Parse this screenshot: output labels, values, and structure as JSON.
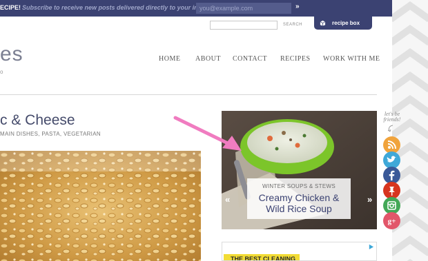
{
  "topbar": {
    "lead": "ECIPE!",
    "message": "Subscribe to receive new posts delivered directly to your inbox:",
    "email_placeholder": "you@example.com",
    "submit": "»"
  },
  "header": {
    "search_button": "SEARCH",
    "recipe_box_label": "recipe box",
    "logo_fragment": "es",
    "logo_sub": "o"
  },
  "nav": {
    "items": [
      "HOME",
      "ABOUT",
      "CONTACT",
      "RECIPES",
      "WORK WITH ME"
    ]
  },
  "post": {
    "title": "c & Cheese",
    "categories": "MAIN DISHES, PASTA, VEGETARIAN"
  },
  "slider": {
    "category": "WINTER SOUPS & STEWS",
    "title": "Creamy Chicken & Wild Rice Soup",
    "prev": "«",
    "next": "»"
  },
  "ad": {
    "text": "THE BEST CLEANING"
  },
  "social": {
    "label_line1": "let's be",
    "label_line2": "friends!",
    "items": [
      {
        "name": "rss-icon",
        "color": "#f0a33c"
      },
      {
        "name": "twitter-icon",
        "color": "#3fa8d8"
      },
      {
        "name": "facebook-icon",
        "color": "#3a5998"
      },
      {
        "name": "pinterest-icon",
        "color": "#d7351f"
      },
      {
        "name": "instagram-icon",
        "color": "#43a857"
      },
      {
        "name": "google-plus-icon",
        "color": "#e2566a"
      }
    ]
  },
  "colors": {
    "brand_navy": "#3b4272",
    "annotation_arrow": "#f07cc0",
    "soup_bowl": "#8bd22e"
  }
}
